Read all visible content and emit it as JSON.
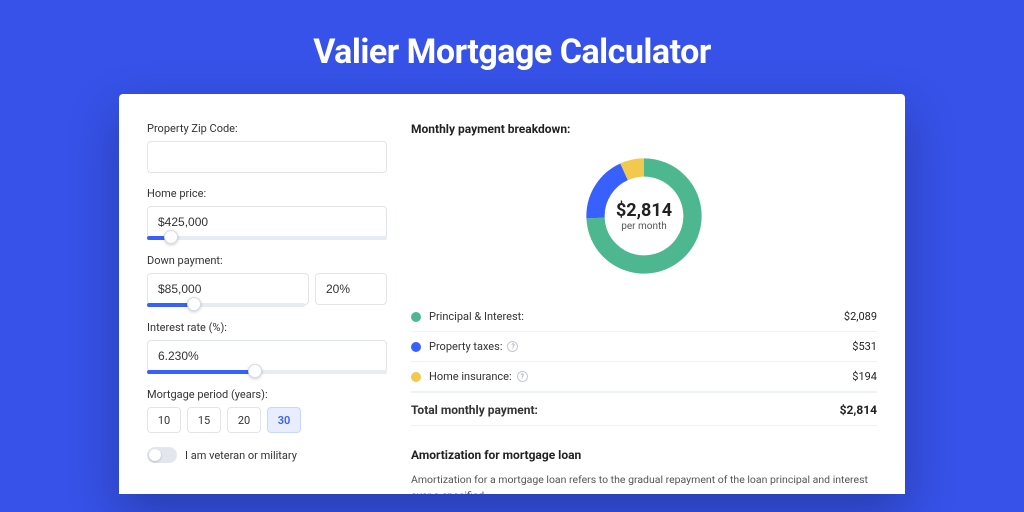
{
  "page": {
    "title": "Valier Mortgage Calculator"
  },
  "form": {
    "zip": {
      "label": "Property Zip Code:",
      "value": ""
    },
    "home_price": {
      "label": "Home price:",
      "value": "$425,000",
      "slider_pct": 10
    },
    "down_payment": {
      "label": "Down payment:",
      "amount": "$85,000",
      "pct": "20%",
      "slider_pct": 30
    },
    "interest_rate": {
      "label": "Interest rate (%):",
      "value": "6.230%",
      "slider_pct": 45
    },
    "period": {
      "label": "Mortgage period (years):",
      "options": [
        "10",
        "15",
        "20",
        "30"
      ],
      "active_index": 3
    },
    "veteran": {
      "label": "I am veteran or military",
      "checked": false
    }
  },
  "breakdown": {
    "title": "Monthly payment breakdown:",
    "donut": {
      "amount": "$2,814",
      "sub": "per month"
    },
    "rows": [
      {
        "color": "green",
        "label": "Principal & Interest:",
        "value": "$2,089",
        "info": false
      },
      {
        "color": "blue",
        "label": "Property taxes:",
        "value": "$531",
        "info": true
      },
      {
        "color": "yellow",
        "label": "Home insurance:",
        "value": "$194",
        "info": true
      }
    ],
    "total_label": "Total monthly payment:",
    "total_value": "$2,814"
  },
  "chart_data": {
    "type": "pie",
    "title": "Monthly payment breakdown",
    "series": [
      {
        "name": "Principal & Interest",
        "value": 2089,
        "color": "#4db890"
      },
      {
        "name": "Property taxes",
        "value": 531,
        "color": "#3860ff"
      },
      {
        "name": "Home insurance",
        "value": 194,
        "color": "#f2c94c"
      }
    ],
    "total": 2814,
    "center_label": "$2,814 per month"
  },
  "amort": {
    "title": "Amortization for mortgage loan",
    "text": "Amortization for a mortgage loan refers to the gradual repayment of the loan principal and interest over a specified"
  }
}
